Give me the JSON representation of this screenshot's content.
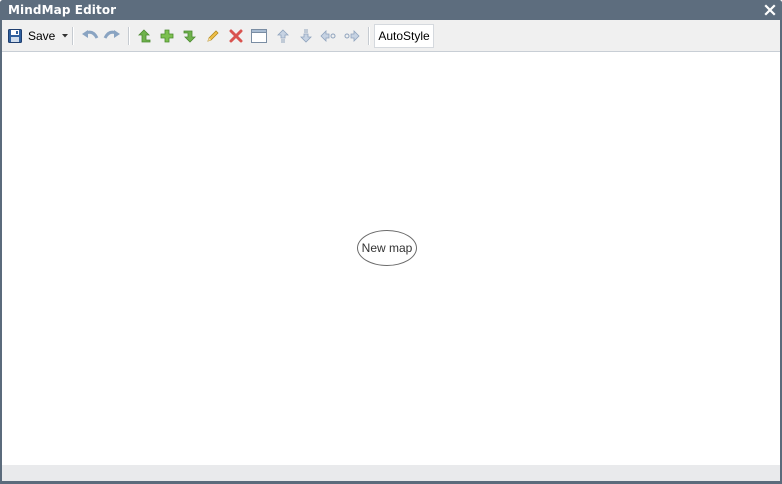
{
  "window": {
    "title": "MindMap Editor"
  },
  "toolbar": {
    "save_label": "Save",
    "buttons": [
      {
        "name": "undo",
        "icon": "undo-icon"
      },
      {
        "name": "redo",
        "icon": "redo-icon"
      },
      {
        "name": "add-parent",
        "icon": "arrow-up-green-icon"
      },
      {
        "name": "add-child",
        "icon": "plus-green-icon"
      },
      {
        "name": "add-sibling",
        "icon": "arrow-down-green-icon"
      },
      {
        "name": "edit",
        "icon": "pencil-icon"
      },
      {
        "name": "delete",
        "icon": "red-x-icon"
      },
      {
        "name": "frame",
        "icon": "window-icon"
      },
      {
        "name": "move-up",
        "icon": "move-up-icon"
      },
      {
        "name": "move-down",
        "icon": "move-down-icon"
      },
      {
        "name": "move-left",
        "icon": "move-left-icon"
      },
      {
        "name": "move-right",
        "icon": "move-right-icon"
      }
    ],
    "autostyle_label": "AutoStyle"
  },
  "canvas": {
    "root_node": {
      "label": "New map"
    }
  },
  "colors": {
    "titlebar": "#5d6d7e",
    "toolbar": "#f0f0f0",
    "canvas": "#ffffff",
    "statusbar": "#e9eaec"
  }
}
